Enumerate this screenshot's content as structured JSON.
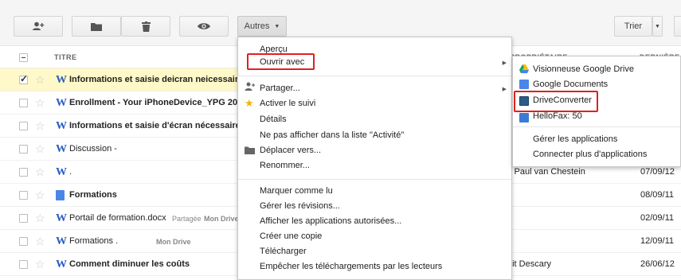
{
  "toolbar": {
    "autres_label": "Autres",
    "trier_label": "Trier",
    "icons": [
      "add-person-icon",
      "folder-icon",
      "trash-icon",
      "eye-icon"
    ]
  },
  "header": {
    "titre": "TITRE",
    "proprietaire": "PROPRIÉTAIRE",
    "derniere": "DERNIÈRE M"
  },
  "files": [
    {
      "title": "Informations et saisie deicran neicessair",
      "bold": true,
      "selected": true,
      "checked": true,
      "icon": "word",
      "tag": "",
      "tag2": "",
      "owner": "",
      "date": ""
    },
    {
      "title": "Enrollment - Your iPhoneDevice_YPG 20",
      "bold": true,
      "selected": false,
      "checked": false,
      "icon": "word",
      "tag": "",
      "tag2": "",
      "owner": "",
      "date": ""
    },
    {
      "title": "Informations et saisie d'écran nécessaire",
      "bold": true,
      "selected": false,
      "checked": false,
      "icon": "word",
      "tag": "",
      "tag2": "",
      "owner": "",
      "date": ""
    },
    {
      "title": "Discussion -",
      "bold": false,
      "selected": false,
      "checked": false,
      "icon": "word",
      "tag": "",
      "tag2": "",
      "owner": "",
      "date": ""
    },
    {
      "title": ".",
      "bold": false,
      "selected": false,
      "checked": false,
      "icon": "word",
      "tag": "",
      "tag2": "",
      "owner": "s Paul van Chestein",
      "date": "07/09/12"
    },
    {
      "title": "Formations",
      "bold": true,
      "selected": false,
      "checked": false,
      "icon": "gdoc",
      "tag": "",
      "tag2": "",
      "owner": "",
      "date": "08/09/11"
    },
    {
      "title": "Portail de formation.docx",
      "bold": false,
      "selected": false,
      "checked": false,
      "icon": "word",
      "tag": "Partagée",
      "tag2": "Mon Drive",
      "owner": "",
      "date": "02/09/11"
    },
    {
      "title": "Formations .",
      "bold": false,
      "selected": false,
      "checked": false,
      "icon": "word",
      "tag": "",
      "tag2": "Mon Drive",
      "owner": "",
      "date": "12/09/11"
    },
    {
      "title": "Comment diminuer les coûts",
      "bold": true,
      "selected": false,
      "checked": false,
      "icon": "word",
      "tag": "",
      "tag2": "",
      "owner": "bit Descary",
      "date": "26/06/12"
    }
  ],
  "menu": {
    "apercu": "Aperçu",
    "ouvrir_avec": "Ouvrir avec",
    "partager": "Partager...",
    "activer_suivi": "Activer le suivi",
    "details": "Détails",
    "ne_pas_afficher": "Ne pas afficher dans la liste \"Activité\"",
    "deplacer": "Déplacer vers...",
    "renommer": "Renommer...",
    "marquer_lu": "Marquer comme lu",
    "gerer_revisions": "Gérer les révisions...",
    "afficher_apps": "Afficher les applications autorisées...",
    "creer_copie": "Créer une copie",
    "telecharger": "Télécharger",
    "empecher": "Empêcher les téléchargements par les lecteurs"
  },
  "submenu": {
    "visionneuse": "Visionneuse Google Drive",
    "google_docs": "Google Documents",
    "driveconverter": "DriveConverter",
    "hellofax": "HelloFax: 50",
    "gerer_apps": "Gérer les applications",
    "connecter": "Connecter plus d'applications"
  },
  "colors": {
    "highlight": "#e02020",
    "selected_row": "#fff8c8",
    "word_blue": "#2a5fc1"
  }
}
